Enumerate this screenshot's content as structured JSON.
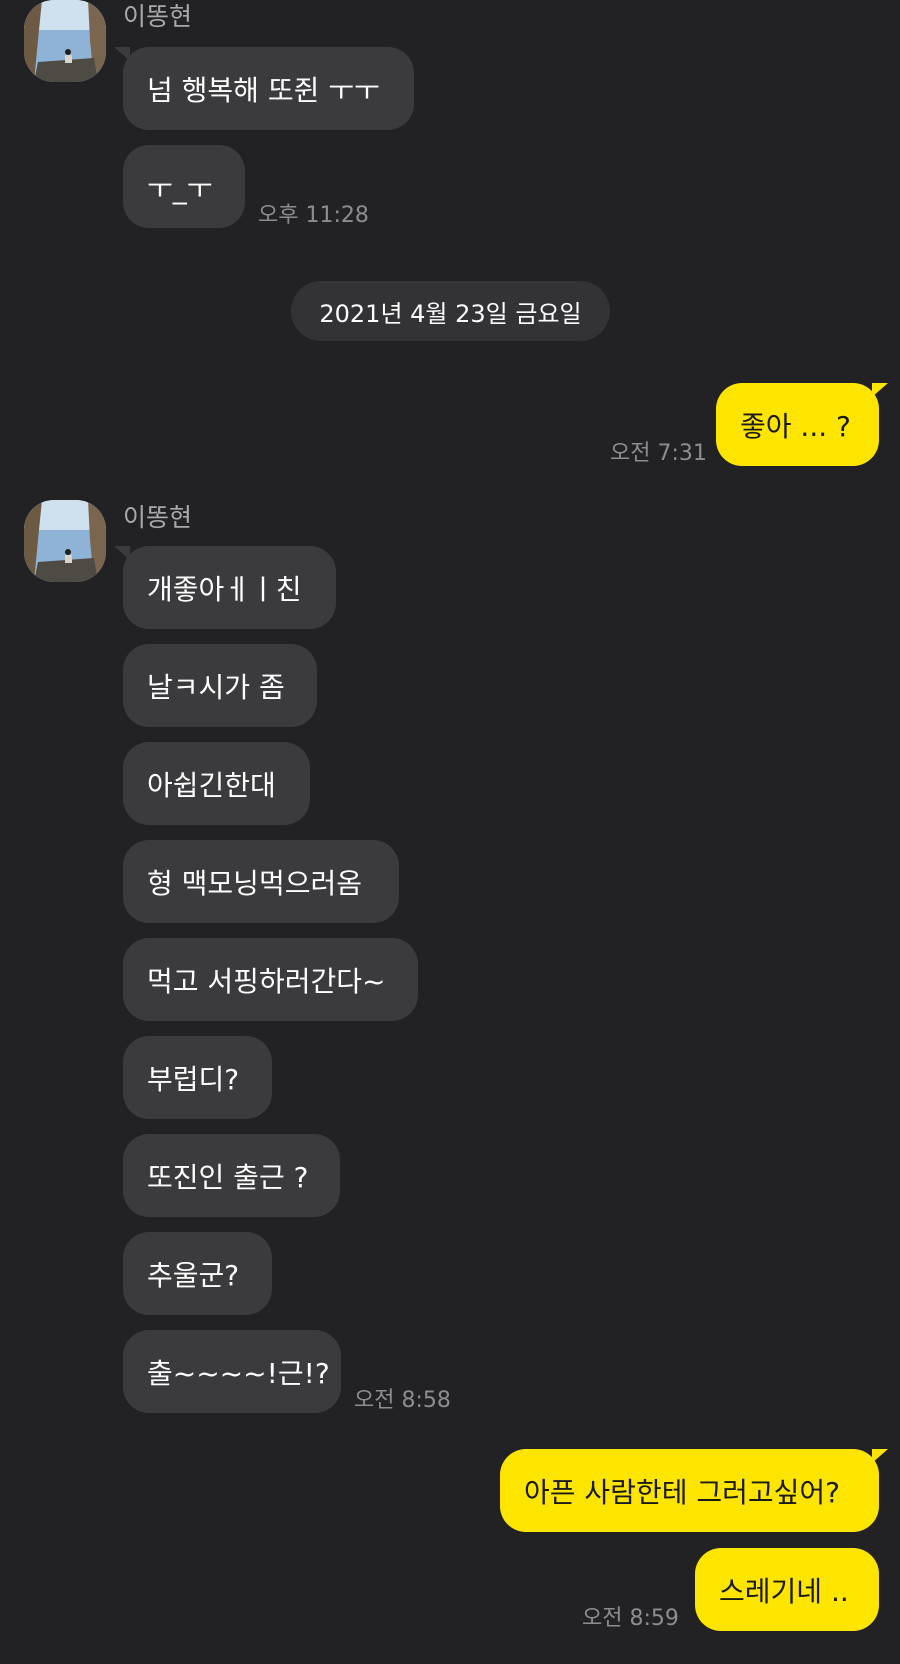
{
  "sender_name": "이똥현",
  "date_separator": "2021년 4월 23일 금요일",
  "messages": [
    {
      "text": "넘 행복해 또쥔 ㅜㅜ"
    },
    {
      "text": "ㅜ_ㅜ",
      "time": "오후 11:28"
    },
    {
      "text": "좋아 ... ?",
      "time": "오전 7:31"
    },
    {
      "text": "개좋아ㅔㅣ친"
    },
    {
      "text": "날ㅋ시가 좀"
    },
    {
      "text": "아쉽긴한대"
    },
    {
      "text": "형 맥모닝먹으러옴"
    },
    {
      "text": "먹고 서핑하러간다~"
    },
    {
      "text": "부럽디?"
    },
    {
      "text": "또진인 출근 ?"
    },
    {
      "text": "추울군?"
    },
    {
      "text": "출~~~~!근!?",
      "time": "오전 8:58"
    },
    {
      "text": "아픈 사람한테 그러고싶어?"
    },
    {
      "text": "스레기네 ..",
      "time": "오전 8:59"
    }
  ],
  "colors": {
    "background": "#222224",
    "incoming_bubble": "#3b3b3e",
    "outgoing_bubble": "#fee500",
    "timestamp": "#8d8d91"
  }
}
